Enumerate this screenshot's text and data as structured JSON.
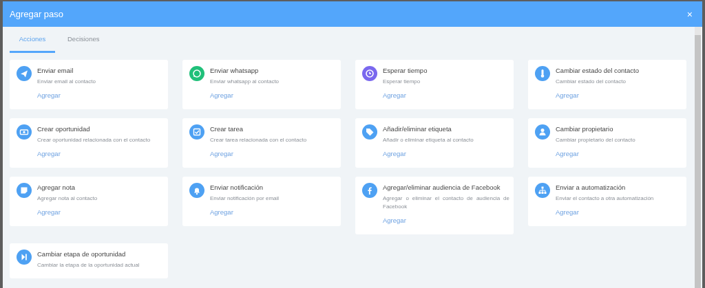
{
  "dialog": {
    "title": "Agregar paso",
    "close": "×"
  },
  "tabs": [
    {
      "label": "Acciones",
      "selected": true
    },
    {
      "label": "Decisiones",
      "selected": false
    }
  ],
  "actions": [
    {
      "color": "#4ea1f3",
      "title": "Enviar email",
      "description": "Enviar email al contacto",
      "link": "Agregar"
    },
    {
      "color": "#20c07a",
      "title": "Enviar whatsapp",
      "description": "Enviar whatsapp al contacto",
      "link": "Agregar"
    },
    {
      "color": "#7a68ee",
      "title": "Esperar tiempo",
      "description": "Esperar tiempo",
      "link": "Agregar"
    },
    {
      "color": "#4ea1f3",
      "title": "Cambiar estado del contacto",
      "description": "Cambiar estado del contacto",
      "link": "Agregar"
    },
    {
      "color": "#4ea1f3",
      "title": "Crear oportunidad",
      "description": "Crear oportunidad relacionada con el contacto",
      "link": "Agregar"
    },
    {
      "color": "#4ea1f3",
      "title": "Crear tarea",
      "description": "Crear tarea relacionada con el contacto",
      "link": "Agregar"
    },
    {
      "color": "#4ea1f3",
      "title": "Añadir/eliminar etiqueta",
      "description": "Añadir o eliminar etiqueta al contacto",
      "link": "Agregar"
    },
    {
      "color": "#4ea1f3",
      "title": "Cambiar propietario",
      "description": "Cambiar propietario del contacto",
      "link": "Agregar"
    },
    {
      "color": "#4ea1f3",
      "title": "Agregar nota",
      "description": "Agregar nota al contacto",
      "link": "Agregar"
    },
    {
      "color": "#4ea1f3",
      "title": "Enviar notificación",
      "description": "Enviar notificación por email",
      "link": "Agregar"
    },
    {
      "color": "#4ea1f3",
      "title": "Agregar/eliminar audiencia de Facebook",
      "description": "Agregar o eliminar el contacto de audiencia de Facebook",
      "link": "Agregar"
    },
    {
      "color": "#4ea1f3",
      "title": "Enviar a automatización",
      "description": "Enviar el contacto a otra automatización",
      "link": "Agregar"
    },
    {
      "color": "#4ea1f3",
      "title": "Cambiar etapa de oportunidad",
      "description": "Cambiar la etapa de la oportunidad actual"
    }
  ]
}
